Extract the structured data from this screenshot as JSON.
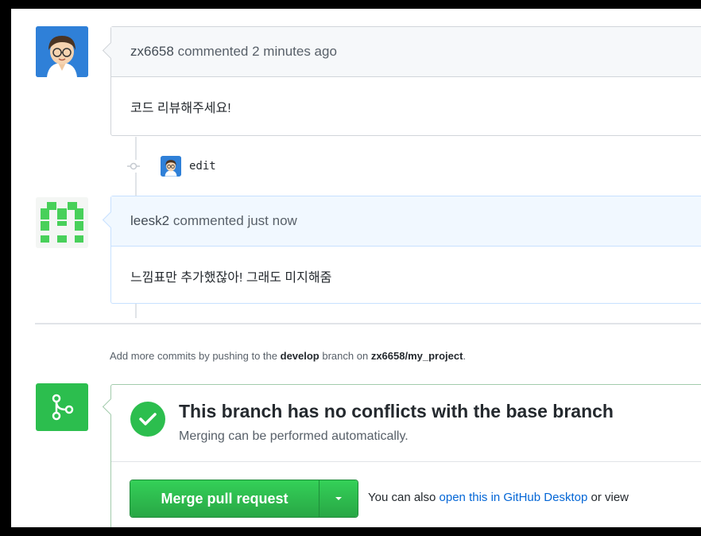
{
  "comments": [
    {
      "author": "zx6658",
      "action": "commented",
      "time": "2 minutes ago",
      "body": "코드 리뷰해주세요!"
    },
    {
      "author": "leesk2",
      "action": "commented",
      "time": "just now",
      "body": "느낌표만 추가했잖아! 그래도 미지해줌"
    }
  ],
  "edit_event": {
    "label": "edit"
  },
  "push_hint": {
    "prefix": "Add more commits by pushing to the",
    "branch": "develop",
    "middle": "branch on",
    "repo": "zx6658/my_project",
    "suffix": "."
  },
  "merge": {
    "title": "This branch has no conflicts with the base branch",
    "subtitle": "Merging can be performed automatically.",
    "button_label": "Merge pull request",
    "hint_prefix": "You can also",
    "hint_link": "open this in GitHub Desktop",
    "hint_suffix": "or view"
  },
  "colors": {
    "accent_green": "#2cbe4e",
    "link_blue": "#0366d6",
    "highlight_header": "#f1f8ff"
  },
  "icons": {
    "avatar_1": "avatar-icon",
    "avatar_2": "identicon",
    "merge": "git-merge-icon",
    "check": "check-icon",
    "dropdown": "triangle-down-icon",
    "commit_dot": "commit-dot-icon"
  }
}
